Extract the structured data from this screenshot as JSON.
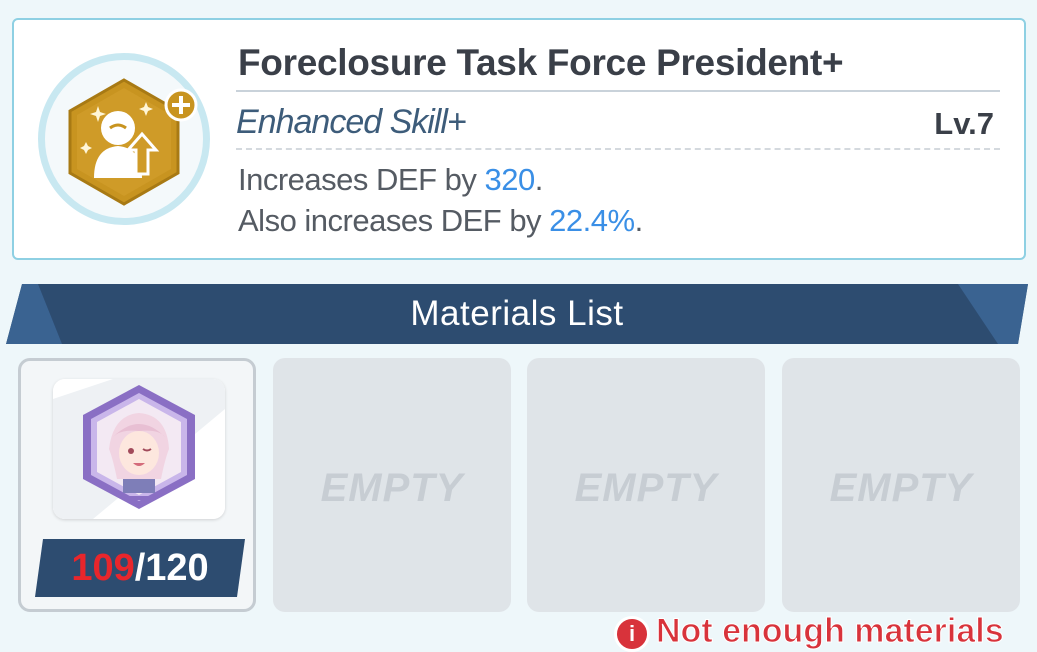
{
  "skill": {
    "name": "Foreclosure Task Force President+",
    "type": "Enhanced Skill+",
    "level": "Lv.7",
    "line1_prefix": "Increases DEF by ",
    "line1_value": "320",
    "line1_suffix": ".",
    "line2_prefix": "Also increases DEF by ",
    "line2_value": "22.4%",
    "line2_suffix": ".",
    "icon": "buff-up-icon",
    "badge_icon": "plus-badge-icon"
  },
  "materials": {
    "header": "Materials List",
    "slots": [
      {
        "icon": "character-memory-item-icon",
        "have": "109",
        "separator": "/",
        "need": "120"
      },
      {
        "label": "EMPTY"
      },
      {
        "label": "EMPTY"
      },
      {
        "label": "EMPTY"
      }
    ]
  },
  "warning": {
    "icon": "info-icon",
    "icon_glyph": "i",
    "text": "Not enough materials"
  },
  "colors": {
    "accent_blue": "#3a8fe6",
    "header_navy": "#2d4c70",
    "warning_red": "#d8333b",
    "insufficient_red": "#e8262c",
    "skill_gold": "#c89420"
  }
}
